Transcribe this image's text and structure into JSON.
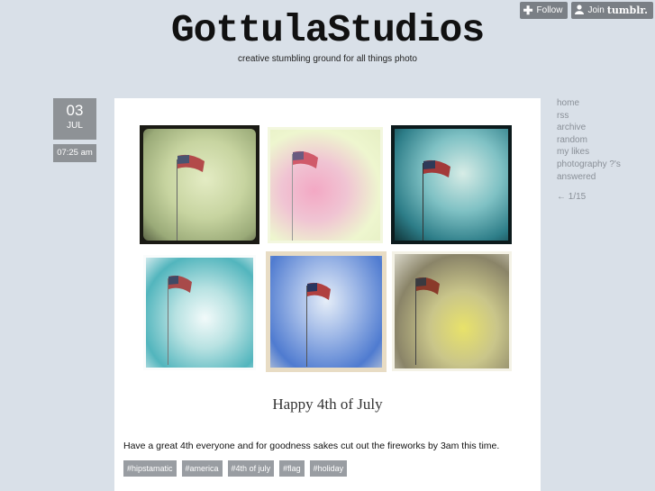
{
  "tumblr": {
    "follow_label": "Follow",
    "join_label": "Join",
    "brand": "tumblr."
  },
  "site": {
    "title": "GottulaStudios",
    "tagline": "creative stumbling ground for all things photo"
  },
  "post": {
    "day": "03",
    "month": "JUL",
    "time": "07:25 am",
    "image_caption": "Happy 4th of July",
    "text": "Have a great 4th everyone and for goodness sakes cut out the fireworks by 3am this time.",
    "tags": [
      "#hipstamatic",
      "#america",
      "#4th of july",
      "#flag",
      "#holiday"
    ]
  },
  "nav": {
    "items": [
      "home",
      "rss",
      "archive",
      "random",
      "my likes",
      "photography ?'s",
      "answered"
    ],
    "pager": "← 1/15"
  },
  "colors": {
    "background": "#d9e0e8",
    "badge": "#8e9296",
    "tag": "#999da2",
    "nav_link": "#8a9098"
  }
}
